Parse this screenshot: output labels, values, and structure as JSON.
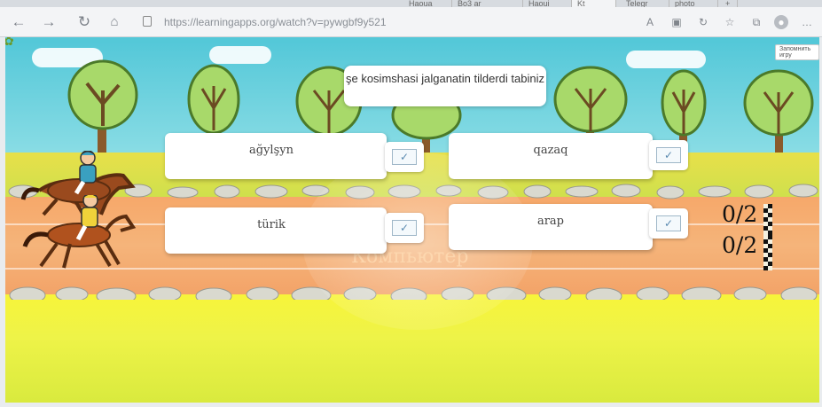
{
  "browser": {
    "tabs": [
      "",
      "",
      "Haoua",
      "Bo3 ar",
      "Haoui",
      "",
      "Kt",
      "",
      "Telegr",
      "photo",
      "+"
    ],
    "url": "https://learningapps.org/watch?v=pywgbf9y521",
    "nav_icons": [
      "back-icon",
      "forward-icon",
      "reload-icon",
      "home-icon"
    ],
    "toolbar_icons": [
      "read-aloud-icon",
      "extension-icon",
      "refresh-icon",
      "favorites-icon",
      "collections-icon",
      "profile-icon",
      "more-icon"
    ]
  },
  "game": {
    "fullscreen_label": "Запомнить игру",
    "question": "şe kosimshasi jalganatin tilderdi tabiniz",
    "answers": [
      {
        "label": "ağylşyn",
        "check": "✓"
      },
      {
        "label": "qazaq",
        "check": "✓"
      },
      {
        "label": "türik",
        "check": "✓"
      },
      {
        "label": "arap",
        "check": "✓"
      }
    ],
    "scores": [
      "0/2",
      "0/2"
    ],
    "watermark": "Компьютер",
    "colors": {
      "sky": "#52c7d8",
      "grass": "#e8e04a",
      "track": "#f6a86a",
      "tree_crown": "#a8d96a"
    }
  }
}
